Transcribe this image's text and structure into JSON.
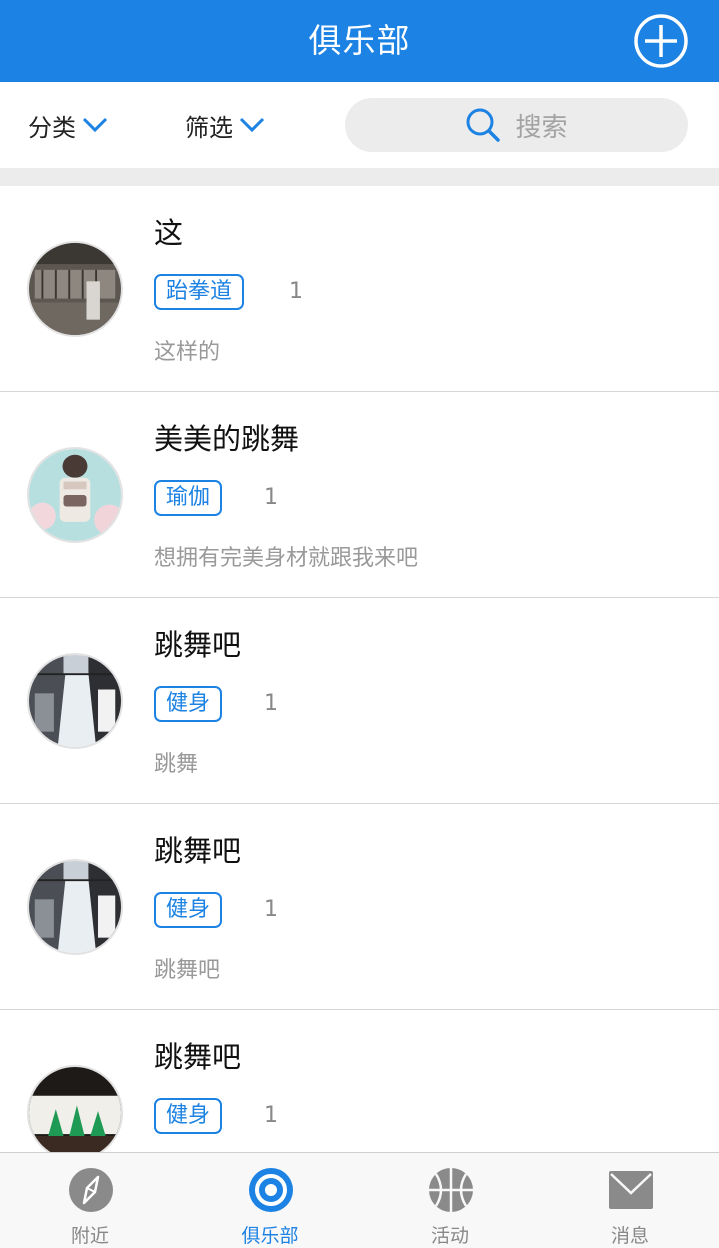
{
  "header": {
    "title": "俱乐部",
    "add_icon": "plus-circle-icon"
  },
  "filters": {
    "category_label": "分类",
    "filter_label": "筛选"
  },
  "search": {
    "placeholder": "搜索",
    "icon": "search-icon"
  },
  "clubs": [
    {
      "name": "这",
      "tag": "跆拳道",
      "count": "1",
      "description": "这样的"
    },
    {
      "name": "美美的跳舞",
      "tag": "瑜伽",
      "count": "1",
      "description": "想拥有完美身材就跟我来吧"
    },
    {
      "name": "跳舞吧",
      "tag": "健身",
      "count": "1",
      "description": "跳舞"
    },
    {
      "name": "跳舞吧",
      "tag": "健身",
      "count": "1",
      "description": "跳舞吧"
    },
    {
      "name": "跳舞吧",
      "tag": "健身",
      "count": "1",
      "description": ""
    }
  ],
  "tabbar": {
    "items": [
      {
        "label": "附近",
        "icon": "compass-icon"
      },
      {
        "label": "俱乐部",
        "icon": "target-icon"
      },
      {
        "label": "活动",
        "icon": "basketball-icon"
      },
      {
        "label": "消息",
        "icon": "envelope-icon"
      }
    ],
    "active_index": 1
  },
  "colors": {
    "accent": "#1c82e3",
    "muted": "#999999",
    "divider": "#d6d6d6"
  }
}
